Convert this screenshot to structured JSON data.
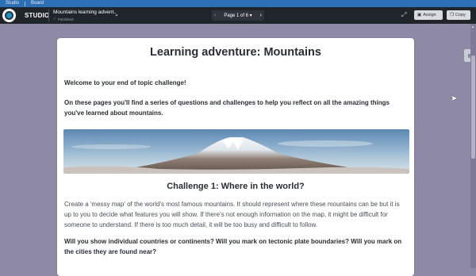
{
  "topbar": {
    "tab1": "Studio",
    "tab2": "Board"
  },
  "appbar": {
    "brand": "STUDIO",
    "doc_title": "Mountains learning advent...",
    "doc_status": "Published",
    "pager_label": "Page 1 of 6 ▾",
    "assign_label": "Assign",
    "copy_label": "Copy"
  },
  "content": {
    "title": "Learning adventure: Mountains",
    "welcome": "Welcome to your end of topic challenge!",
    "intro": "On these pages you'll find a series of questions and challenges to help you reflect on all the amazing things you've learned about mountains.",
    "challenge_heading": "Challenge 1: Where in the world?",
    "challenge_text": "Create a 'messy map' of the world's most famous mountains. It should represent where these mountains can be but it is up to you to decide what features you will show. If there's not enough information on the map, it might be difficult for someone to understand. If there is too much detail, it will be too busy and difficult to follow.",
    "questions": "Will you show individual countries or continents? Will you mark on tectonic plate boundaries? Will you mark on the cities they are found near?"
  },
  "icons": {
    "logo": "studio-logo",
    "status": "check-icon",
    "expand": "expand-icon",
    "assign": "assign-icon",
    "copy": "copy-icon",
    "side": "book-icon"
  }
}
